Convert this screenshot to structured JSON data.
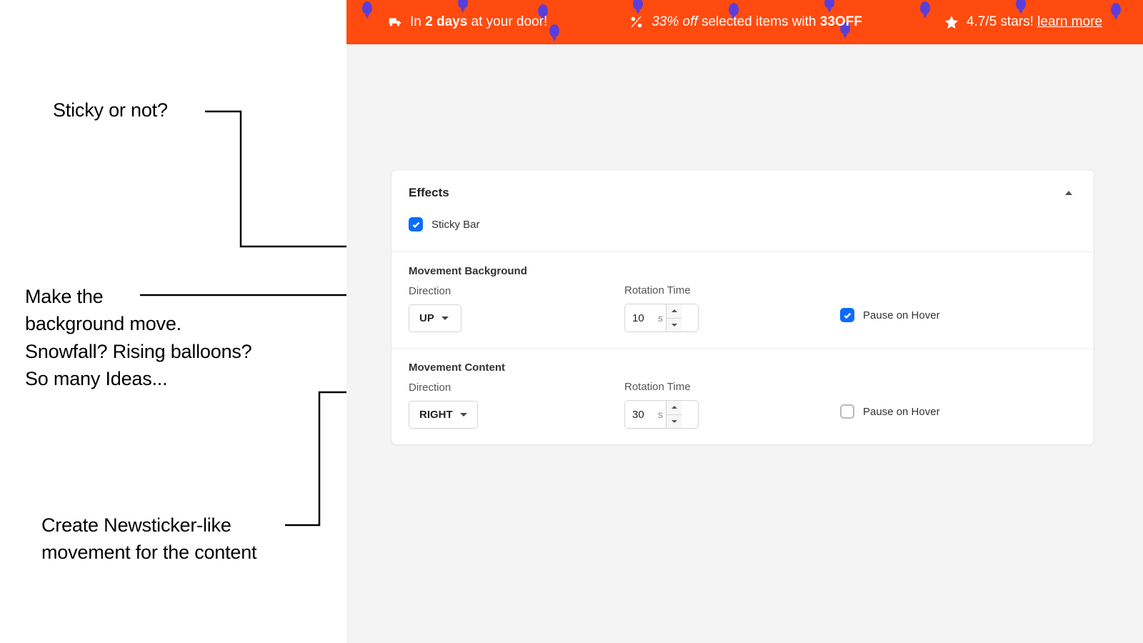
{
  "annotations": {
    "sticky": "Sticky or not?",
    "background": "Make the\nbackground move.\nSnowfall? Rising balloons?\nSo many Ideas...",
    "content": "Create Newsticker-like\nmovement for the content"
  },
  "promo": {
    "item1_prefix": "In ",
    "item1_bold": "2 days",
    "item1_suffix": " at your door!",
    "item2_italic": "33% off",
    "item2_mid": " selected items with ",
    "item2_bold": "33OFF",
    "item3_prefix": "4.7/5 stars! ",
    "item3_link": "learn more"
  },
  "card": {
    "title": "Effects",
    "sticky_label": "Sticky Bar",
    "bg_title": "Movement Background",
    "ct_title": "Movement Content",
    "direction_label": "Direction",
    "rotation_label": "Rotation Time",
    "pause_label": "Pause on Hover",
    "unit": "s",
    "bg_direction": "UP",
    "bg_rotation": "10",
    "ct_direction": "RIGHT",
    "ct_rotation": "30"
  }
}
